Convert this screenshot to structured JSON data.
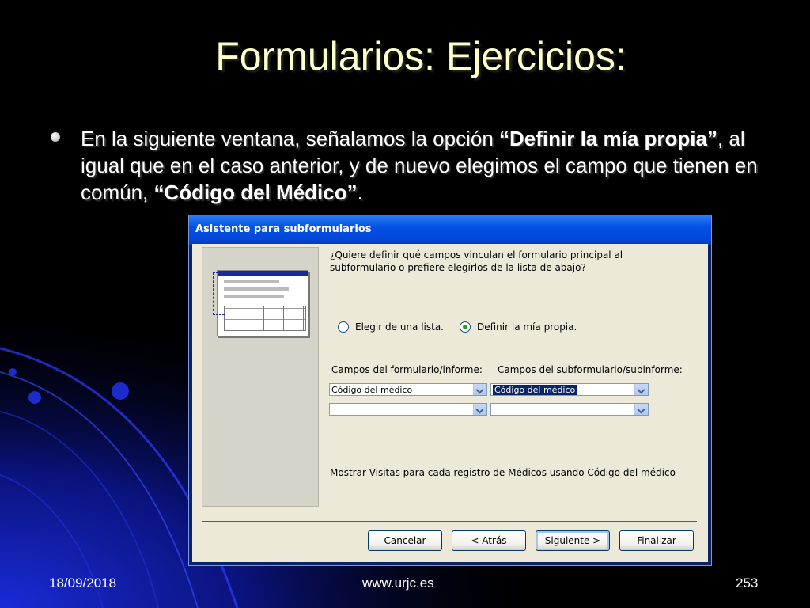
{
  "slide": {
    "title": "Formularios: Ejercicios:",
    "bullet": {
      "part1": "En la siguiente ventana, señalamos la opción ",
      "bold1": "“Definir la mía propia”",
      "part2": ", al igual que en el caso anterior, y de nuevo elegimos el campo que tienen en común, ",
      "bold2": "“Código del Médico”",
      "part3": "."
    },
    "footer": {
      "date": "18/09/2018",
      "url": "www.urjc.es",
      "page": "253"
    }
  },
  "dialog": {
    "title": "Asistente para subformularios",
    "question": "¿Quiere definir qué campos vinculan el formulario principal al subformulario o prefiere elegirlos de la lista de abajo?",
    "options": {
      "list": "Elegir de una lista.",
      "custom": "Definir la mía propia.",
      "selected": "custom"
    },
    "form_fields_label": "Campos del formulario/informe:",
    "subform_fields_label": "Campos del subformulario/subinforme:",
    "form_field_1": "Código del médico",
    "form_field_2": "",
    "subform_field_1": "Código del médico",
    "subform_field_2": "",
    "summary": "Mostrar Visitas para cada registro de Médicos usando Código del médico",
    "buttons": {
      "cancel": "Cancelar",
      "back": "< Atrás",
      "next": "Siguiente >",
      "finish": "Finalizar"
    }
  }
}
